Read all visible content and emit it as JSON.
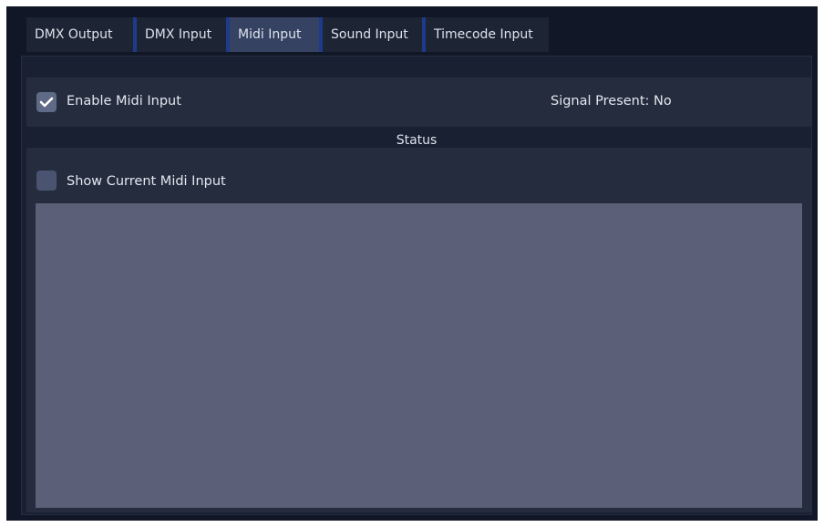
{
  "tabs": [
    {
      "label": "DMX Output",
      "active": false
    },
    {
      "label": "DMX Input",
      "active": false
    },
    {
      "label": "Midi Input",
      "active": true
    },
    {
      "label": "Sound Input",
      "active": false
    },
    {
      "label": "Timecode Input",
      "active": false
    }
  ],
  "enable": {
    "label": "Enable Midi Input",
    "checked": true,
    "check_icon": "checkmark-icon"
  },
  "signal": {
    "text": "Signal Present: No"
  },
  "status": {
    "title": "Status",
    "show_current_label": "Show Current Midi Input",
    "show_current_checked": false
  },
  "colors": {
    "tab_accent": "#1e3a8a",
    "active_tab": "#354262",
    "background": "#111726",
    "panel": "#242c3d",
    "display": "#5b5f77"
  }
}
